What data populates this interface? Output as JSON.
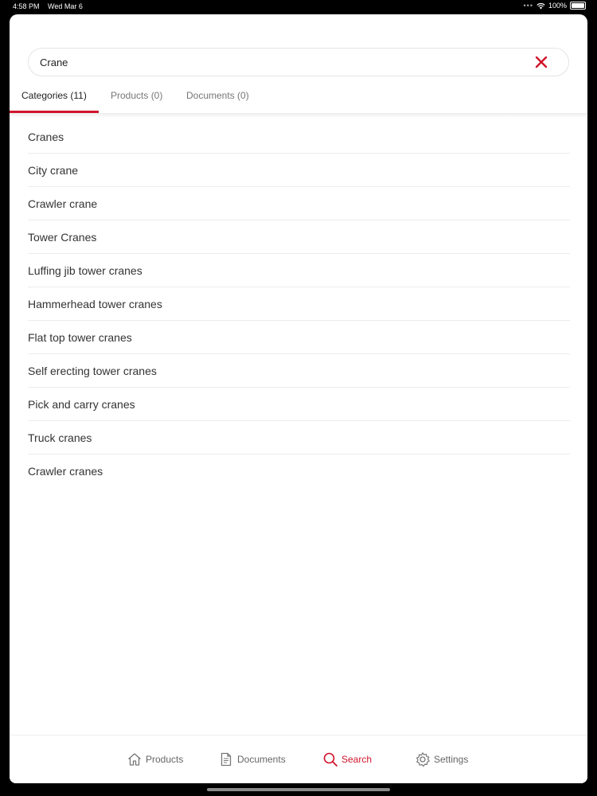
{
  "status_bar": {
    "time": "4:58 PM",
    "date": "Wed Mar 6",
    "battery": "100%"
  },
  "search": {
    "value": "Crane",
    "placeholder": ""
  },
  "tabs": [
    {
      "label": "Categories (11)",
      "active": true
    },
    {
      "label": "Products (0)",
      "active": false
    },
    {
      "label": "Documents (0)",
      "active": false
    }
  ],
  "results": [
    "Cranes",
    "City crane",
    "Crawler crane",
    "Tower Cranes",
    "Luffing jib tower cranes",
    "Hammerhead tower cranes",
    "Flat top tower cranes",
    "Self erecting tower cranes",
    "Pick and carry cranes",
    "Truck cranes",
    "Crawler cranes"
  ],
  "bottom_nav": [
    {
      "label": "Products",
      "icon": "home-icon",
      "active": false
    },
    {
      "label": "Documents",
      "icon": "document-icon",
      "active": false
    },
    {
      "label": "Search",
      "icon": "search-icon",
      "active": true
    },
    {
      "label": "Settings",
      "icon": "gear-icon",
      "active": false
    }
  ],
  "colors": {
    "accent": "#d0142c",
    "text": "#333333",
    "muted": "#777777"
  }
}
